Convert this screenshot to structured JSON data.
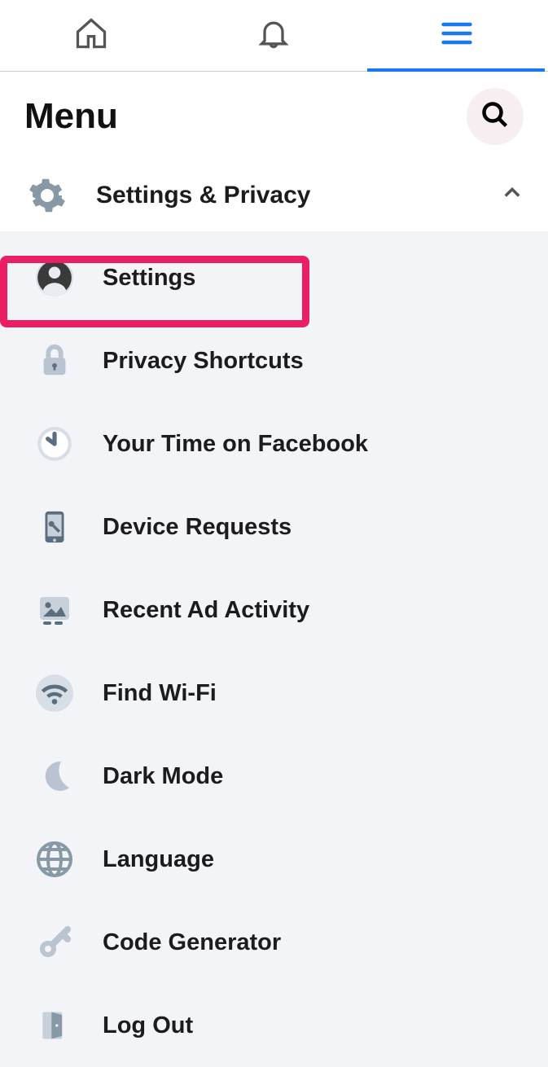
{
  "header": {
    "title": "Menu"
  },
  "section": {
    "title": "Settings & Privacy"
  },
  "items": [
    {
      "label": "Settings"
    },
    {
      "label": "Privacy Shortcuts"
    },
    {
      "label": "Your Time on Facebook"
    },
    {
      "label": "Device Requests"
    },
    {
      "label": "Recent Ad Activity"
    },
    {
      "label": "Find Wi-Fi"
    },
    {
      "label": "Dark Mode"
    },
    {
      "label": "Language"
    },
    {
      "label": "Code Generator"
    },
    {
      "label": "Log Out"
    }
  ]
}
